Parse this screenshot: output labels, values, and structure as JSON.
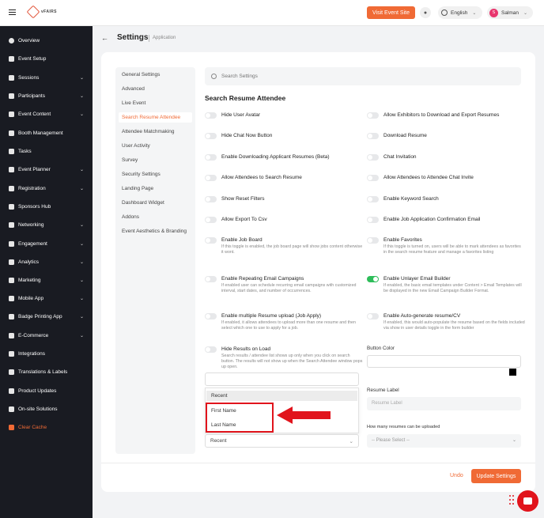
{
  "topbar": {
    "logo_text": "vFAIRS",
    "visit_event_label": "Visit Event Site",
    "language": "English",
    "avatar_initial": "S",
    "user_name": "Salman",
    "accent": "#f06a35"
  },
  "sidebar": {
    "items": [
      {
        "label": "Overview",
        "icon": "overview-icon",
        "chevron": false
      },
      {
        "label": "Event Setup",
        "icon": "gear-icon",
        "chevron": false
      },
      {
        "label": "Sessions",
        "icon": "grid-icon",
        "chevron": true
      },
      {
        "label": "Participants",
        "icon": "people-icon",
        "chevron": true
      },
      {
        "label": "Event Content",
        "icon": "content-icon",
        "chevron": true
      },
      {
        "label": "Booth Management",
        "icon": "booth-icon",
        "chevron": false
      },
      {
        "label": "Tasks",
        "icon": "tasks-icon",
        "chevron": false
      },
      {
        "label": "Event Planner",
        "icon": "planner-icon",
        "chevron": true
      },
      {
        "label": "Registration",
        "icon": "registration-icon",
        "chevron": true
      },
      {
        "label": "Sponsors Hub",
        "icon": "sponsors-icon",
        "chevron": false
      },
      {
        "label": "Networking",
        "icon": "share-icon",
        "chevron": true
      },
      {
        "label": "Engagement",
        "icon": "flag-icon",
        "chevron": true
      },
      {
        "label": "Analytics",
        "icon": "analytics-icon",
        "chevron": true
      },
      {
        "label": "Marketing",
        "icon": "send-icon",
        "chevron": true
      },
      {
        "label": "Mobile App",
        "icon": "mobile-icon",
        "chevron": true
      },
      {
        "label": "Badge Printing App",
        "icon": "badge-icon",
        "chevron": true
      },
      {
        "label": "E-Commerce",
        "icon": "cart-icon",
        "chevron": true
      },
      {
        "label": "Integrations",
        "icon": "integrations-icon",
        "chevron": false
      },
      {
        "label": "Translations & Labels",
        "icon": "translate-icon",
        "chevron": false
      },
      {
        "label": "Product Updates",
        "icon": "updates-icon",
        "chevron": false
      },
      {
        "label": "On-site Solutions",
        "icon": "onsite-icon",
        "chevron": false
      },
      {
        "label": "Clear Cache",
        "icon": "cache-icon",
        "chevron": false
      }
    ]
  },
  "header": {
    "title": "Settings",
    "subtitle": "Application"
  },
  "settings_tabs": [
    "General Settings",
    "Advanced",
    "Live Event",
    "Search Resume Attendee",
    "Attendee Matchmaking",
    "User Activity",
    "Survey",
    "Security Settings",
    "Landing Page",
    "Dashboard Widget",
    "Addons",
    "Event Aesthetics & Branding"
  ],
  "active_tab": "Search Resume Attendee",
  "search": {
    "placeholder": "Search Settings"
  },
  "section_title": "Search Resume Attendee",
  "options_left": [
    {
      "label": "Hide User Avatar",
      "desc": "",
      "on": false
    },
    {
      "label": "Hide Chat Now Button",
      "desc": "",
      "on": false
    },
    {
      "label": "Enable Downloading Applicant Resumes (Beta)",
      "desc": "",
      "on": false
    },
    {
      "label": "Allow Attendees to Search Resume",
      "desc": "",
      "on": false
    },
    {
      "label": "Show Reset Filters",
      "desc": "",
      "on": false
    },
    {
      "label": "Allow Export To Csv",
      "desc": "",
      "on": false
    },
    {
      "label": "Enable Job Board",
      "desc": "If this toggle is enabled, the job board page will show jobs content otherwise it wont.",
      "on": false
    },
    {
      "label": "Enable Repeating Email Campaigns",
      "desc": "If enabled user can schedule recurring email campaigns with customized interval, start dates, and number of occurrences.",
      "on": false
    },
    {
      "label": "Enable multiple Resume upload (Job Apply)",
      "desc": "If enabled, it allows attendees to upload more than one resume and then select which one to use to apply for a job.",
      "on": false
    },
    {
      "label": "Hide Results on Load",
      "desc": "Search results / attendee list shows up only when you click on search button. The results will not show up when the Search Attendee window pops up open.",
      "on": false
    }
  ],
  "options_right": [
    {
      "label": "Allow Exhibitors to Download and Export Resumes",
      "desc": "",
      "on": false
    },
    {
      "label": "Download Resume",
      "desc": "",
      "on": false
    },
    {
      "label": "Chat Invitation",
      "desc": "",
      "on": false
    },
    {
      "label": "Allow Attendees to Attendee Chat Invite",
      "desc": "",
      "on": false
    },
    {
      "label": "Enable Keyword Search",
      "desc": "",
      "on": false
    },
    {
      "label": "Enable Job Application Confirmation Email",
      "desc": "",
      "on": false
    },
    {
      "label": "Enable Favorites",
      "desc": "If this toggle is turned on, users will be able to mark attendees as favorites in the search resume feature and manage a favorites listing",
      "on": false
    },
    {
      "label": "Enable Unlayer Email Builder",
      "desc": "If enabled, the basic email templates under Content > Email Templates will be displayed in the new Email Campaign Builder Format.",
      "on": true
    },
    {
      "label": "Enable Auto-generate resume/CV",
      "desc": "If enabled, this would auto-populate the resume based on the fields included via show in user details toggle in the form builder",
      "on": false
    }
  ],
  "button_color_label": "Button Color",
  "button_color": "#000000",
  "resume_label": {
    "label": "Resume Label",
    "placeholder": "Resume Label"
  },
  "resume_count": {
    "label": "How many resumes can be uploaded",
    "value": "-- Please Select --"
  },
  "sort_dropdown": {
    "options": [
      "Recent",
      "First Name",
      "Last Name"
    ],
    "selected": "Recent"
  },
  "footer": {
    "undo_label": "Undo",
    "update_label": "Update Settings"
  },
  "annotation_color": "#e1141c"
}
